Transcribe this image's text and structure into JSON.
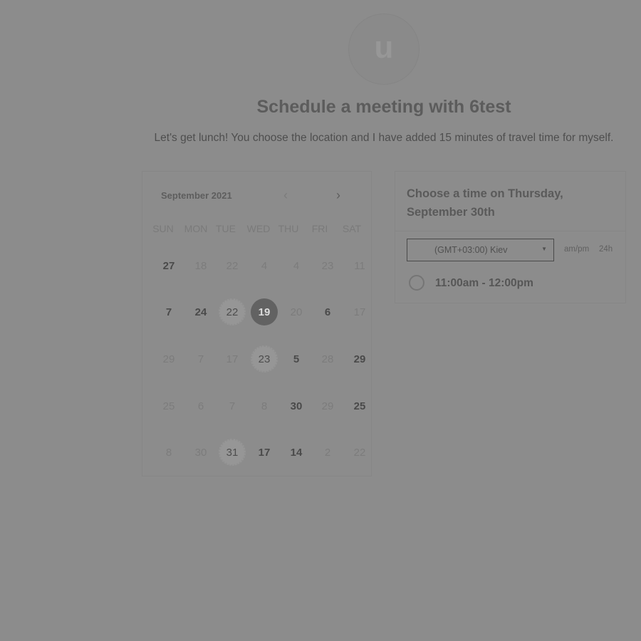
{
  "host": {
    "avatar_initial": "u"
  },
  "header": {
    "title": "Schedule a meeting with 6test",
    "description": "Let's get lunch! You choose the location and I have added 15 minutes of travel time for myself."
  },
  "calendar": {
    "month_label": "September 2021",
    "prev_icon": "chevron-left-icon",
    "next_icon": "chevron-right-icon",
    "prev_glyph": "‹",
    "next_glyph": "›",
    "weekdays": [
      "SUN",
      "MON",
      "TUE",
      "WED",
      "THU",
      "FRI",
      "SAT"
    ],
    "weeks": [
      [
        {
          "label": "27",
          "state": "bold"
        },
        {
          "label": "18",
          "state": "dim"
        },
        {
          "label": "22",
          "state": "dim"
        },
        {
          "label": "4",
          "state": "dim"
        },
        {
          "label": "4",
          "state": "dim"
        },
        {
          "label": "23",
          "state": "dim"
        },
        {
          "label": "11",
          "state": "dim"
        }
      ],
      [
        {
          "label": "7",
          "state": "bold"
        },
        {
          "label": "24",
          "state": "bold"
        },
        {
          "label": "22",
          "state": "dotted"
        },
        {
          "label": "19",
          "state": "selected"
        },
        {
          "label": "20",
          "state": "dim"
        },
        {
          "label": "6",
          "state": "bold"
        },
        {
          "label": "17",
          "state": "dim"
        }
      ],
      [
        {
          "label": "29",
          "state": "dim"
        },
        {
          "label": "7",
          "state": "dim"
        },
        {
          "label": "17",
          "state": "dim"
        },
        {
          "label": "23",
          "state": "dotted"
        },
        {
          "label": "5",
          "state": "bold"
        },
        {
          "label": "28",
          "state": "dim"
        },
        {
          "label": "29",
          "state": "bold"
        }
      ],
      [
        {
          "label": "25",
          "state": "dim"
        },
        {
          "label": "6",
          "state": "dim"
        },
        {
          "label": "7",
          "state": "dim"
        },
        {
          "label": "8",
          "state": "dim"
        },
        {
          "label": "30",
          "state": "bold"
        },
        {
          "label": "29",
          "state": "dim"
        },
        {
          "label": "25",
          "state": "bold"
        }
      ],
      [
        {
          "label": "8",
          "state": "dim"
        },
        {
          "label": "30",
          "state": "dim"
        },
        {
          "label": "31",
          "state": "dotted"
        },
        {
          "label": "17",
          "state": "bold"
        },
        {
          "label": "14",
          "state": "bold"
        },
        {
          "label": "2",
          "state": "dim"
        },
        {
          "label": "22",
          "state": "dim"
        }
      ]
    ]
  },
  "time_panel": {
    "heading": "Choose a time on Thursday, September 30th",
    "timezone": {
      "value": "(GMT+03:00) Kiev",
      "icon": "caret-down-icon",
      "glyph": "▼"
    },
    "formats": [
      "am/pm",
      "24h"
    ],
    "slots": [
      {
        "label": "11:00am - 12:00pm",
        "selected": false
      }
    ]
  },
  "colors": {
    "overlay": "#8c8c8c",
    "selected_day": "#626262",
    "title_text": "#5c5c5c"
  }
}
